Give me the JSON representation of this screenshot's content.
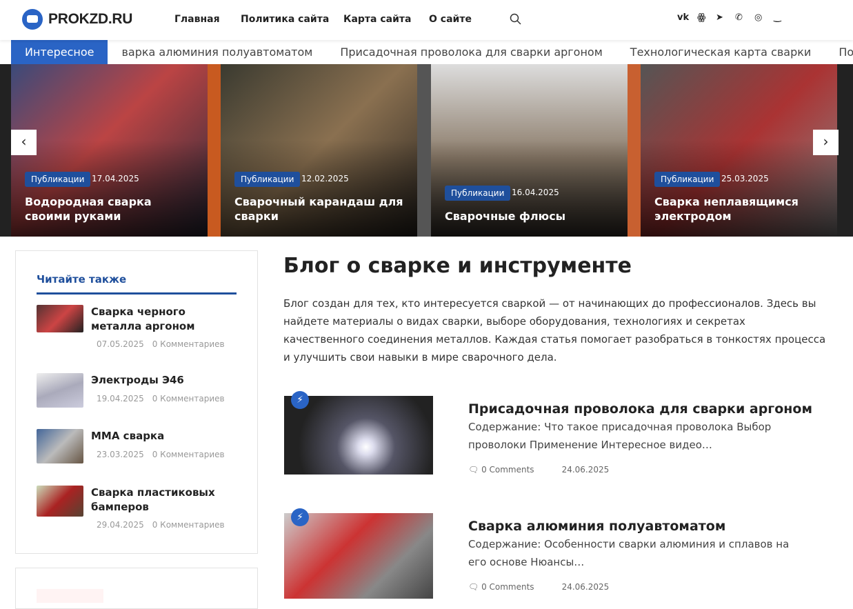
{
  "header": {
    "logo": "PROKZD.RU",
    "nav": [
      "Главная",
      "Политика сайта",
      "Карта сайта",
      "О сайте"
    ],
    "social": [
      "VK",
      "OK",
      "Telegram",
      "Viber",
      "WhatsApp",
      "Max"
    ]
  },
  "ticker": {
    "label": "Интересное",
    "items": [
      "варка алюминия полуавтоматом",
      "Присадочная проволока для сварки аргоном",
      "Технологическая карта сварки",
      "Полуавтоматичес"
    ]
  },
  "slider": [
    {
      "category": "Публикации",
      "date": "17.04.2025",
      "title": "Водородная сварка своими руками"
    },
    {
      "category": "Публикации",
      "date": "12.02.2025",
      "title": "Сварочный карандаш для сварки"
    },
    {
      "category": "Публикации",
      "date": "16.04.2025",
      "title": "Сварочные флюсы"
    },
    {
      "category": "Публикации",
      "date": "25.03.2025",
      "title": "Сварка неплавящимся электродом"
    }
  ],
  "sidebar": {
    "title": "Читайте также",
    "items": [
      {
        "title": "Сварка черного металла аргоном",
        "date": "07.05.2025",
        "comments": "0 Комментариев"
      },
      {
        "title": "Электроды Э46",
        "date": "19.04.2025",
        "comments": "0 Комментариев"
      },
      {
        "title": "ММА сварка",
        "date": "23.03.2025",
        "comments": "0 Комментариев"
      },
      {
        "title": "Сварка пластиковых бамперов",
        "date": "29.04.2025",
        "comments": "0 Комментариев"
      }
    ]
  },
  "main": {
    "title": "Блог о сварке и инструменте",
    "intro": "Блог создан для тех, кто интересуется сваркой — от начинающих до профессионалов. Здесь вы найдете материалы о видах сварки, выборе оборудования, технологиях и секретах качественного соединения металлов. Каждая статья помогает разобраться в тонкостях процесса и улучшить свои навыки в мире сварочного дела.",
    "posts": [
      {
        "title": "Присадочная проволока для сварки аргоном",
        "excerpt": "Содержание: Что такое присадочная проволока Выбор проволоки Применение Интересное видео…",
        "comments": "0 Comments",
        "date": "24.06.2025"
      },
      {
        "title": "Сварка алюминия полуавтоматом",
        "excerpt": "Содержание: Особенности сварки алюминия и сплавов на его основе Нюансы…",
        "comments": "0 Comments",
        "date": "24.06.2025"
      }
    ]
  }
}
